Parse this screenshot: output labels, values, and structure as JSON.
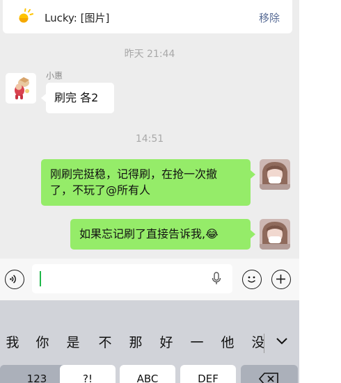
{
  "pinned": {
    "text": "Lucky: [图片]",
    "action": "移除"
  },
  "messages": [
    {
      "type": "time",
      "text": "昨天 21:44"
    },
    {
      "type": "received",
      "sender": "小惠",
      "text": "刷完 各2"
    },
    {
      "type": "time",
      "text": "14:51"
    },
    {
      "type": "sent",
      "lines": [
        "刚刷完挺稳，记得刷，在抢一次撤",
        "了，不玩了@所有人"
      ]
    },
    {
      "type": "sent",
      "text": "如果忘记刷了直接告诉我,😂"
    }
  ],
  "input": {
    "value": ""
  },
  "icons": {
    "pin": "sun-icon",
    "voice": "voice-icon",
    "mic": "microphone-icon",
    "emoji": "smiley-icon",
    "plus": "plus-icon",
    "chevron": "chevron-down-icon",
    "backspace": "backspace-icon"
  },
  "keyboard": {
    "candidates": [
      "我",
      "你",
      "是",
      "不",
      "那",
      "好",
      "一",
      "他",
      "没"
    ],
    "keys": [
      "123",
      "?!",
      "ABC",
      "DEF"
    ]
  },
  "colors": {
    "sent_bubble": "#95ec69",
    "link": "#576b95",
    "caret": "#1fb84a"
  }
}
